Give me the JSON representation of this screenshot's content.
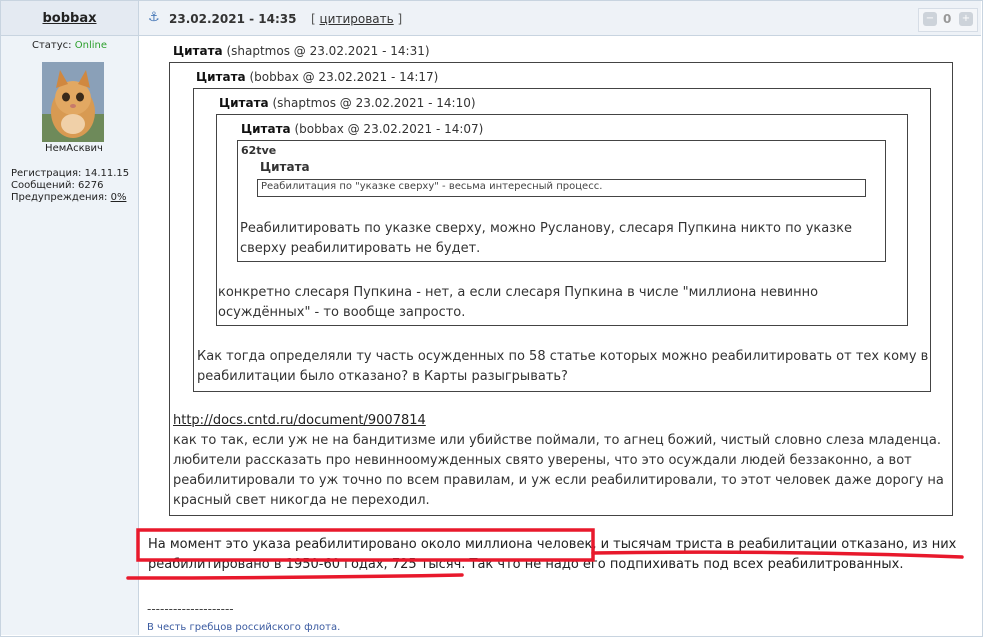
{
  "post": {
    "author": "bobbax",
    "date": "23.02.2021 - 14:35",
    "cite_open": "[ ",
    "cite_label": "цитировать",
    "cite_close": " ]",
    "votes": "0"
  },
  "user": {
    "status_label": "Статус: ",
    "status_value": "Online",
    "nickname": "НемАсквич",
    "reg": "Регистрация: 14.11.15",
    "messages": "Сообщений: 6276",
    "warnings_label": "Предупреждения: ",
    "warnings_value": "0%"
  },
  "quotes": {
    "q1": {
      "label": "Цитата",
      "meta": " (shaptmos @ 23.02.2021 - 14:31)"
    },
    "q2": {
      "label": "Цитата",
      "meta": " (bobbax @ 23.02.2021 - 14:17)"
    },
    "q3": {
      "label": "Цитата",
      "meta": " (shaptmos @ 23.02.2021 - 14:10)"
    },
    "q4": {
      "label": "Цитата",
      "meta": " (bobbax @ 23.02.2021 - 14:07)"
    },
    "q5": {
      "author": "62tve",
      "inner_label": "Цитата",
      "inner_text": "Реабилитация по \"указке сверху\" - весьма интересный процесс."
    },
    "t5": [
      "Реабилитировать по указке сверху, можно Русланову, слесаря Пупкина никто по указке",
      "сверху реабилитировать не будет."
    ],
    "t4": [
      "конкретно слесаря Пупкина - нет, а если слесаря Пупкина в числе \"миллиона невинно",
      "осуждённых\" - то вообще запросто."
    ],
    "t3": [
      "Как тогда определяли ту часть осужденных по 58 статье которых можно реабилитировать от тех кому в",
      "реабилитации было отказано? в Карты разыгрывать?"
    ],
    "t2_link": "http://docs.cntd.ru/document/9007814",
    "t2": [
      "как то так, если уж не на бандитизме или убийстве поймали, то агнец божий, чистый словно слеза младенца.",
      "любители рассказать про невинноомужденных свято уверены, что это осуждали людей беззаконно, а вот",
      "реабилитировали то уж точно по всем правилам, и уж если реабилитировали, то этот человек даже дорогу на",
      "красный свет никогда не переходил."
    ]
  },
  "main_text": [
    "На момент это указа реабилитировано около миллиона человек, и тысячам триста в реабилитации отказано, из них",
    "реабилитировано в 1950-60 годах, 725 тысяч. Так что не надо его подпихивать под всех реабилитрованных."
  ],
  "signature": {
    "separator": "--------------------",
    "text": "В честь гребцов российского флота."
  },
  "colors": {
    "annotation": "#e8192c",
    "online": "#2ea02e",
    "header_bg": "#e4eaf2"
  }
}
